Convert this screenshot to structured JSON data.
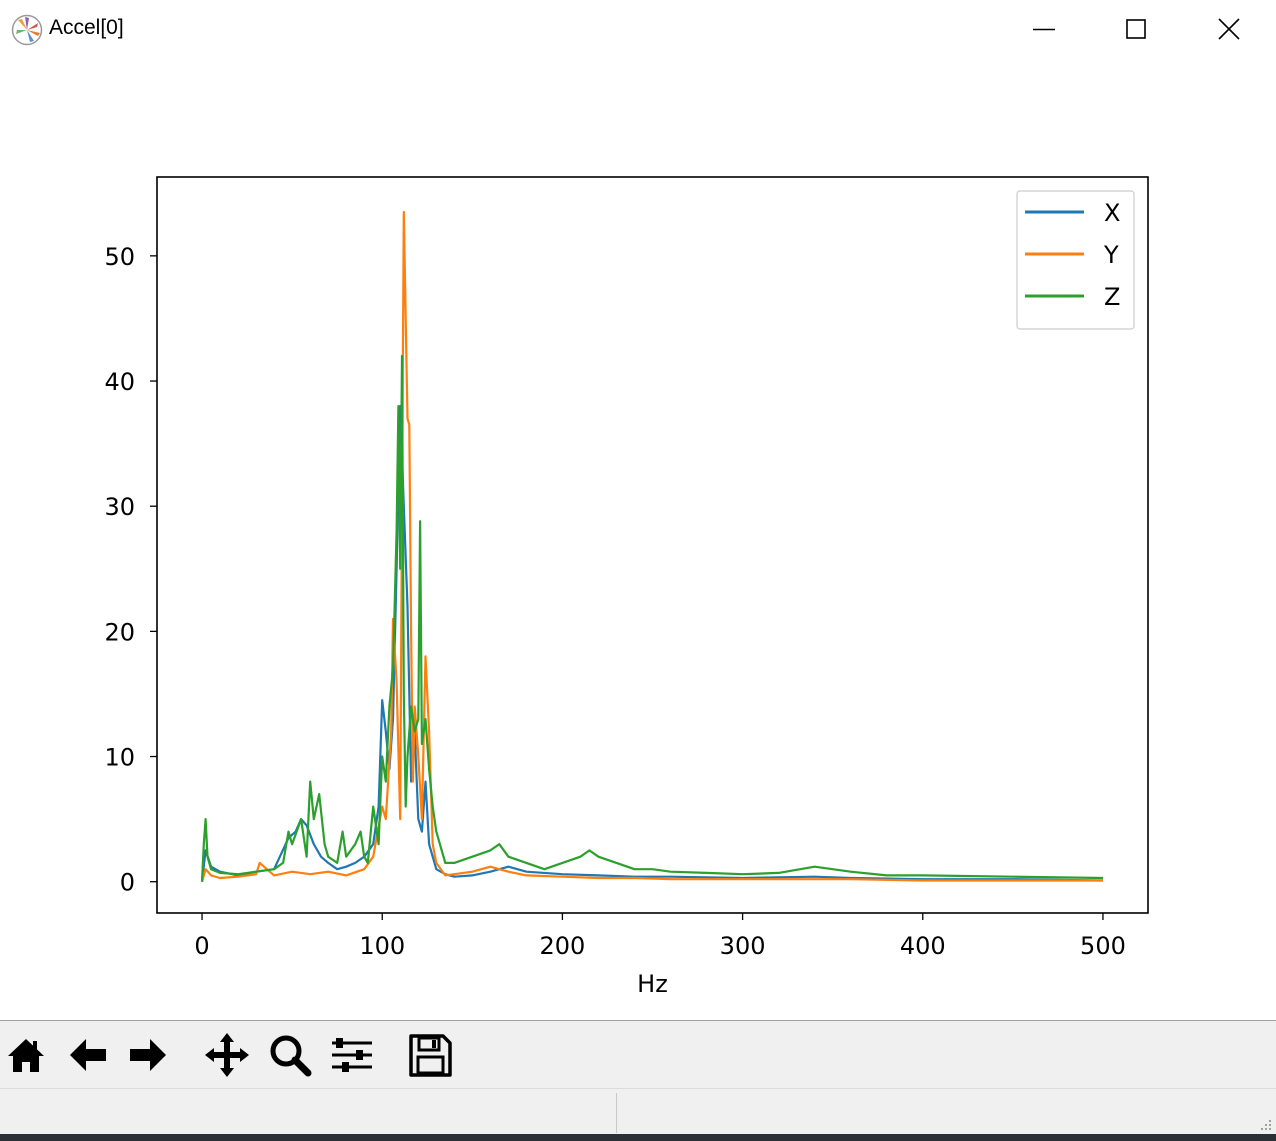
{
  "window": {
    "title": "Accel[0]",
    "icon": "matplotlib-logo-icon"
  },
  "toolbar": {
    "tools": [
      "home-icon",
      "back-arrow-icon",
      "forward-arrow-icon",
      "pan-move-icon",
      "zoom-magnifier-icon",
      "subplots-sliders-icon",
      "save-floppy-icon"
    ]
  },
  "chart_data": {
    "type": "line",
    "title": "",
    "xlabel": "Hz",
    "ylabel": "",
    "xlim": [
      -25,
      525
    ],
    "ylim": [
      -2.5,
      56.3
    ],
    "xticks": [
      0,
      100,
      200,
      300,
      400,
      500
    ],
    "yticks": [
      0,
      10,
      20,
      30,
      40,
      50
    ],
    "grid": false,
    "legend_position": "top-right",
    "series": [
      {
        "name": "X",
        "color": "#1f77b4",
        "x": [
          0,
          2,
          5,
          10,
          20,
          30,
          40,
          48,
          52,
          55,
          58,
          62,
          66,
          70,
          75,
          80,
          85,
          90,
          95,
          98,
          100,
          102,
          104,
          106,
          108,
          110,
          112,
          114,
          116,
          118,
          120,
          122,
          124,
          126,
          128,
          130,
          135,
          140,
          150,
          160,
          170,
          180,
          200,
          220,
          240,
          260,
          300,
          340,
          360,
          400,
          450,
          500
        ],
        "y": [
          0,
          2.5,
          1.2,
          0.8,
          0.5,
          0.8,
          1.0,
          3.5,
          4.0,
          5.0,
          4.5,
          3.0,
          2.0,
          1.5,
          1.0,
          1.2,
          1.5,
          2.0,
          3.0,
          6.0,
          14.5,
          12.0,
          9.0,
          13.0,
          25.0,
          38.0,
          30.0,
          22.0,
          8.0,
          12.0,
          5.0,
          4.0,
          8.0,
          3.0,
          2.0,
          1.0,
          0.6,
          0.4,
          0.5,
          0.8,
          1.2,
          0.8,
          0.6,
          0.5,
          0.4,
          0.4,
          0.3,
          0.4,
          0.3,
          0.2,
          0.2,
          0.1
        ]
      },
      {
        "name": "Y",
        "color": "#ff7f0e",
        "x": [
          0,
          2,
          5,
          10,
          20,
          30,
          32,
          40,
          50,
          60,
          70,
          80,
          90,
          95,
          100,
          102,
          105,
          106,
          108,
          110,
          111,
          112,
          113,
          114,
          115,
          116,
          117,
          118,
          120,
          122,
          124,
          126,
          128,
          130,
          135,
          140,
          150,
          160,
          170,
          180,
          200,
          220,
          240,
          260,
          300,
          340,
          360,
          400,
          450,
          500
        ],
        "y": [
          0,
          1.0,
          0.5,
          0.3,
          0.4,
          0.6,
          1.5,
          0.5,
          0.8,
          0.6,
          0.8,
          0.5,
          1.0,
          2.0,
          6.0,
          5.0,
          12.0,
          21.0,
          16.0,
          5.0,
          30.0,
          53.5,
          45.0,
          37.0,
          36.5,
          20.0,
          8.0,
          14.0,
          10.0,
          5.0,
          18.0,
          12.0,
          3.0,
          1.5,
          0.5,
          0.6,
          0.8,
          1.2,
          0.8,
          0.5,
          0.4,
          0.3,
          0.3,
          0.2,
          0.2,
          0.2,
          0.2,
          0.1,
          0.1,
          0.1
        ]
      },
      {
        "name": "Z",
        "color": "#2ca02c",
        "x": [
          0,
          1,
          2,
          3,
          5,
          10,
          20,
          30,
          40,
          45,
          48,
          50,
          55,
          58,
          60,
          62,
          65,
          68,
          70,
          75,
          78,
          80,
          85,
          88,
          90,
          92,
          95,
          98,
          100,
          102,
          104,
          106,
          108,
          109,
          110,
          111,
          112,
          113,
          114,
          116,
          118,
          120,
          121,
          122,
          124,
          126,
          128,
          130,
          135,
          140,
          150,
          160,
          165,
          170,
          180,
          190,
          200,
          210,
          215,
          220,
          230,
          240,
          250,
          260,
          280,
          300,
          320,
          340,
          360,
          380,
          400,
          450,
          500
        ],
        "y": [
          0,
          3.0,
          5.0,
          2.0,
          1.0,
          0.7,
          0.6,
          0.8,
          1.0,
          1.5,
          4.0,
          3.0,
          5.0,
          2.0,
          8.0,
          5.0,
          7.0,
          3.0,
          2.0,
          1.5,
          4.0,
          2.0,
          3.0,
          4.0,
          2.0,
          1.5,
          6.0,
          3.0,
          10.0,
          8.0,
          14.0,
          17.0,
          28.0,
          38.0,
          25.0,
          42.0,
          15.0,
          6.0,
          10.0,
          14.0,
          12.0,
          13.0,
          28.8,
          11.0,
          13.0,
          9.0,
          6.0,
          4.0,
          1.5,
          1.5,
          2.0,
          2.5,
          3.0,
          2.0,
          1.5,
          1.0,
          1.5,
          2.0,
          2.5,
          2.0,
          1.5,
          1.0,
          1.0,
          0.8,
          0.7,
          0.6,
          0.7,
          1.2,
          0.8,
          0.5,
          0.5,
          0.4,
          0.3
        ]
      }
    ]
  }
}
